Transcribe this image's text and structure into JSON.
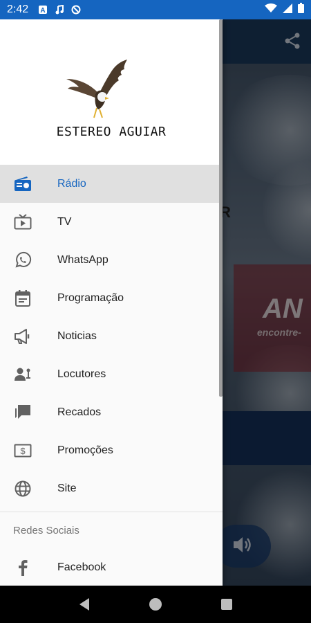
{
  "status_bar": {
    "time": "2:42",
    "icons": [
      "a-app-icon",
      "music-note-icon",
      "circle-at-icon"
    ],
    "right_icons": [
      "wifi-icon",
      "signal-icon",
      "battery-icon"
    ]
  },
  "background_app": {
    "share_icon": "share-icon",
    "banner_big": "AN",
    "banner_small": "encontre-",
    "partial_letter": "R",
    "volume_icon": "volume-icon"
  },
  "drawer": {
    "logo_text": "ESTEREO AGUIAR",
    "items": [
      {
        "label": "Rádio",
        "icon": "radio-icon",
        "active": true
      },
      {
        "label": "TV",
        "icon": "tv-icon"
      },
      {
        "label": "WhatsApp",
        "icon": "whatsapp-icon"
      },
      {
        "label": "Programação",
        "icon": "calendar-icon"
      },
      {
        "label": "Noticias",
        "icon": "megaphone-icon"
      },
      {
        "label": "Locutores",
        "icon": "person-mic-icon"
      },
      {
        "label": "Recados",
        "icon": "chat-icon"
      },
      {
        "label": "Promoções",
        "icon": "dollar-icon"
      },
      {
        "label": "Site",
        "icon": "globe-icon"
      }
    ],
    "section_title": "Redes Sociais",
    "social_items": [
      {
        "label": "Facebook",
        "icon": "facebook-icon"
      }
    ]
  },
  "colors": {
    "accent": "#1565c0",
    "active_bg": "#e0e0e0",
    "icon_gray": "#616161"
  }
}
